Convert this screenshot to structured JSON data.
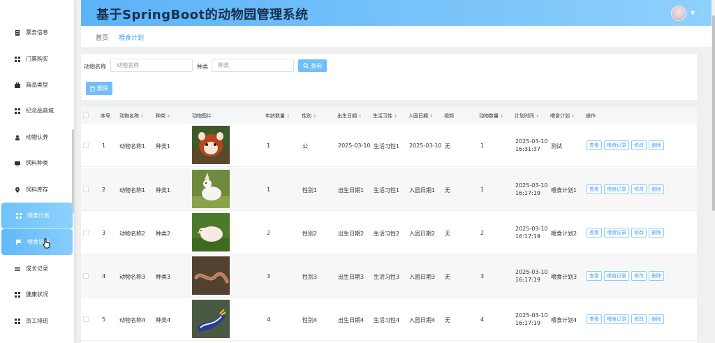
{
  "header": {
    "title": "基于SpringBoot的动物园管理系统"
  },
  "sidebar": {
    "items": [
      {
        "label": "票务信息",
        "icon": "document-icon"
      },
      {
        "label": "门票购买",
        "icon": "grid-icon"
      },
      {
        "label": "商品类型",
        "icon": "briefcase-icon"
      },
      {
        "label": "纪念品商城",
        "icon": "grid-icon"
      },
      {
        "label": "动物认养",
        "icon": "user-icon"
      },
      {
        "label": "饲料种类",
        "icon": "monitor-icon"
      },
      {
        "label": "饲料库存",
        "icon": "location-pin-icon"
      },
      {
        "label": "喂食计划",
        "icon": "grid-icon"
      },
      {
        "label": "喂食记录",
        "icon": "flag-icon"
      },
      {
        "label": "成长记录",
        "icon": "list-icon"
      },
      {
        "label": "健康状况",
        "icon": "grid-icon"
      },
      {
        "label": "员工排班",
        "icon": "grid-icon"
      }
    ]
  },
  "breadcrumb": {
    "home": "首页",
    "current": "喂食计划"
  },
  "search": {
    "name_label": "动物名称",
    "name_placeholder": "动物名称",
    "type_label": "种类",
    "type_placeholder": "种类",
    "query_label": "查询",
    "delete_label": "删除"
  },
  "table": {
    "headers": [
      "序号",
      "动物名称",
      "种类",
      "动物图片",
      "年龄数量",
      "性别",
      "出生日期",
      "生活习性",
      "入园日期",
      "视频",
      "动物数量",
      "计划时间",
      "喂食计划",
      "操作"
    ],
    "actions": [
      "查看",
      "喂食记录",
      "修改",
      "删除"
    ],
    "rows": [
      {
        "idx": "1",
        "name": "动物名称1",
        "type": "种类1",
        "age": "1",
        "sex": "公",
        "birth": "2025-03-10",
        "habit": "生活习性1",
        "enter": "2025-03-10",
        "video": "无",
        "count": "1",
        "time": "2025-03-10 16:31:37",
        "plan": "测试"
      },
      {
        "idx": "2",
        "name": "动物名称1",
        "type": "种类1",
        "age": "1",
        "sex": "性别1",
        "birth": "出生日期1",
        "habit": "生活习性1",
        "enter": "入园日期1",
        "video": "无",
        "count": "1",
        "time": "2025-03-10 16:17:19",
        "plan": "喂食计划1"
      },
      {
        "idx": "3",
        "name": "动物名称2",
        "type": "种类2",
        "age": "2",
        "sex": "性别2",
        "birth": "出生日期2",
        "habit": "生活习性2",
        "enter": "入园日期2",
        "video": "无",
        "count": "2",
        "time": "2025-03-10 16:17:19",
        "plan": "喂食计划2"
      },
      {
        "idx": "4",
        "name": "动物名称3",
        "type": "种类3",
        "age": "3",
        "sex": "性别3",
        "birth": "出生日期3",
        "habit": "生活习性3",
        "enter": "入园日期3",
        "video": "无",
        "count": "3",
        "time": "2025-03-10 16:17:19",
        "plan": "喂食计划3"
      },
      {
        "idx": "5",
        "name": "动物名称4",
        "type": "种类4",
        "age": "4",
        "sex": "性别4",
        "birth": "出生日期4",
        "habit": "生活习性4",
        "enter": "入园日期4",
        "video": "无",
        "count": "4",
        "time": "2025-03-10 16:17:19",
        "plan": "喂食计划4"
      }
    ]
  },
  "colors": {
    "accent": "#409eff",
    "header_start": "#5cb3f7",
    "header_end": "#8ed0fc"
  }
}
